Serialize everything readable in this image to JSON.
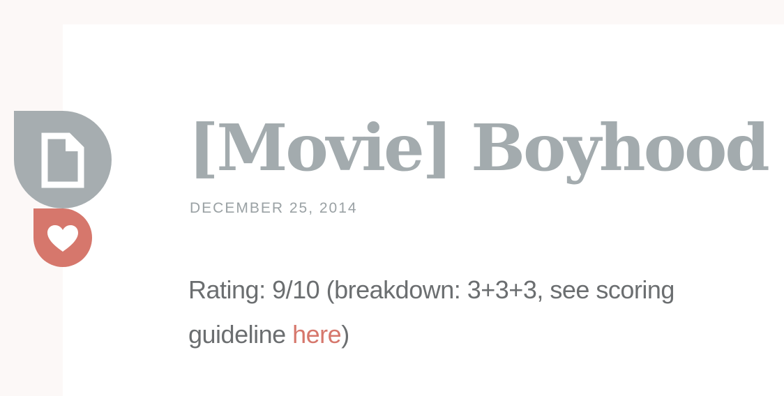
{
  "post": {
    "title": "[Movie] Boyhood",
    "date": "DECEMBER 25, 2014",
    "body": {
      "text_before_link": "Rating: 9/10 (breakdown: 3+3+3, see scoring guideline ",
      "link_text": "here",
      "text_after_link": ")"
    }
  },
  "icons": {
    "post_format": "document-icon",
    "like": "heart-icon"
  },
  "colors": {
    "page_background": "#fcf8f7",
    "card_background": "#ffffff",
    "badge_gray": "#a6adb0",
    "accent": "#d6776c",
    "title": "#a3abae",
    "body_text": "#6b6e70"
  }
}
